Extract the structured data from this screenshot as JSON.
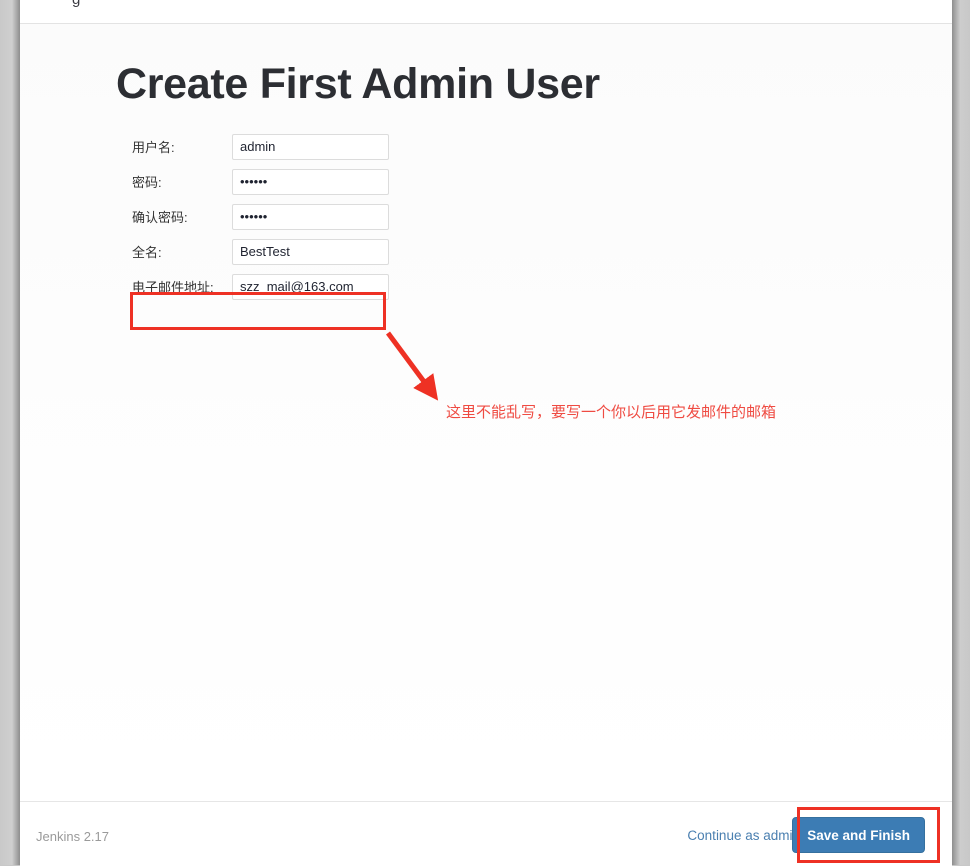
{
  "window": {
    "clipped_top_text": "g"
  },
  "main": {
    "title": "Create First Admin User",
    "form": {
      "fields": [
        {
          "label": "用户名:",
          "value": "admin",
          "type": "text",
          "name": "username"
        },
        {
          "label": "密码:",
          "value": "••••••",
          "type": "password",
          "name": "password"
        },
        {
          "label": "确认密码:",
          "value": "••••••",
          "type": "password",
          "name": "confirm-password"
        },
        {
          "label": "全名:",
          "value": "BestTest",
          "type": "text",
          "name": "full-name"
        },
        {
          "label": "电子邮件地址:",
          "value": "szz_mail@163.com",
          "type": "email",
          "name": "email-address"
        }
      ]
    }
  },
  "annotations": {
    "email_note": "这里不能乱写，要写一个你以后用它发邮件的邮箱",
    "highlight_color": "#ee3124",
    "arrow_color": "#ee3124",
    "text_color": "#ef4b42"
  },
  "footer": {
    "version": "Jenkins 2.17",
    "continue_link": "Continue as admin",
    "submit_button": "Save and Finish",
    "submit_button_color": "#3c7cb4",
    "link_color": "#4a7fb0"
  }
}
